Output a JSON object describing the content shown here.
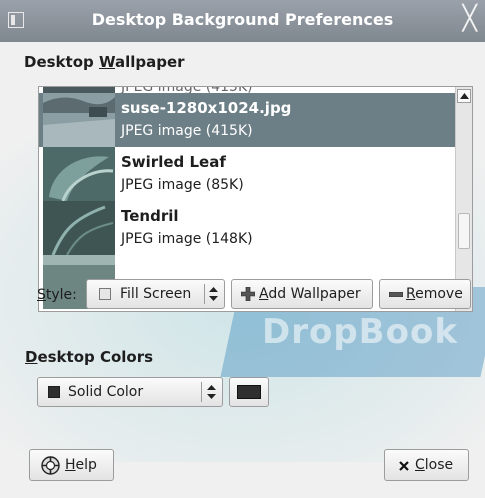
{
  "window": {
    "title": "Desktop Background Preferences"
  },
  "wallpaper_section": {
    "label_prefix": "Desktop ",
    "label_mnemonic": "W",
    "label_rest": "allpaper"
  },
  "wallpapers": [
    {
      "name": "suse-1280x1024.jpg",
      "meta": "JPEG image (415K)"
    },
    {
      "name": "Swirled Leaf",
      "meta": "JPEG image (85K)"
    },
    {
      "name": "Tendril",
      "meta": "JPEG image (148K)"
    }
  ],
  "style_row": {
    "style_label_mnemonic": "S",
    "style_label_rest": "tyle:",
    "style_value": "Fill Screen",
    "add_mnemonic": "A",
    "add_rest": "dd Wallpaper",
    "remove_mnemonic": "R",
    "remove_rest": "emove"
  },
  "colors_section": {
    "label_mnemonic": "D",
    "label_rest": "esktop Colors",
    "color_mode": "Solid Color",
    "swatch_color": "#2f2f2f"
  },
  "footer": {
    "help_mnemonic": "H",
    "help_rest": "elp",
    "close_mnemonic": "C",
    "close_rest": "lose"
  },
  "colors": {
    "selection": "#6d7f86",
    "titlebar": "#8a9199"
  }
}
